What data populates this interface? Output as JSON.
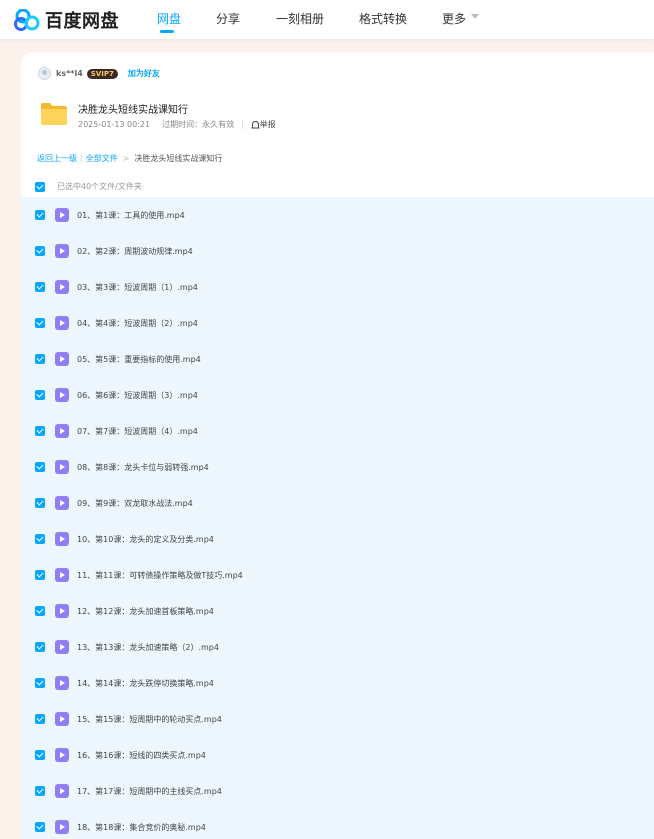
{
  "brand": {
    "name": "百度网盘"
  },
  "nav": {
    "items": [
      "网盘",
      "分享",
      "一刻相册",
      "格式转换",
      "更多"
    ]
  },
  "colors": {
    "accent": "#06a7ff",
    "page_bg": "#fdf1ec",
    "list_bg": "#eef7fe",
    "video_icon": "#8f7ef5"
  },
  "share": {
    "username": "ks**l4",
    "vip_badge": "SVIP7",
    "add_friend": "加为好友",
    "title": "决胜龙头短线实战课知行",
    "date": "2025-01-13 00:21",
    "expiry": "过期时间：永久有效",
    "report": "举报"
  },
  "breadcrumb": {
    "back": "返回上一级",
    "all_files": "全部文件",
    "current": "决胜龙头短线实战课知行"
  },
  "selection": {
    "label": "已选中40个文件/文件夹"
  },
  "files": [
    "01、第1课：工具的使用.mp4",
    "02、第2课：周期波动规律.mp4",
    "03、第3课：短波周期（1）.mp4",
    "04、第4课：短波周期（2）.mp4",
    "05、第5课：重要指标的使用.mp4",
    "06、第6课：短波周期（3）.mp4",
    "07、第7课：短波周期（4）.mp4",
    "08、第8课：龙头卡位与弱转强.mp4",
    "09、第9课：双龙取水战法.mp4",
    "10、第10课：龙头的定义及分类.mp4",
    "11、第11课：可转债操作策略及做T技巧.mp4",
    "12、第12课：龙头加速首板策略.mp4",
    "13、第13课：龙头加速策略（2）.mp4",
    "14、第14课：龙头跌停切换策略.mp4",
    "15、第15课：短周期中的轮动买点.mp4",
    "16、第16课：短线的四类买点.mp4",
    "17、第17课：短周期中的主线买点.mp4",
    "18、第18课：集合竞价的奥秘.mp4"
  ]
}
